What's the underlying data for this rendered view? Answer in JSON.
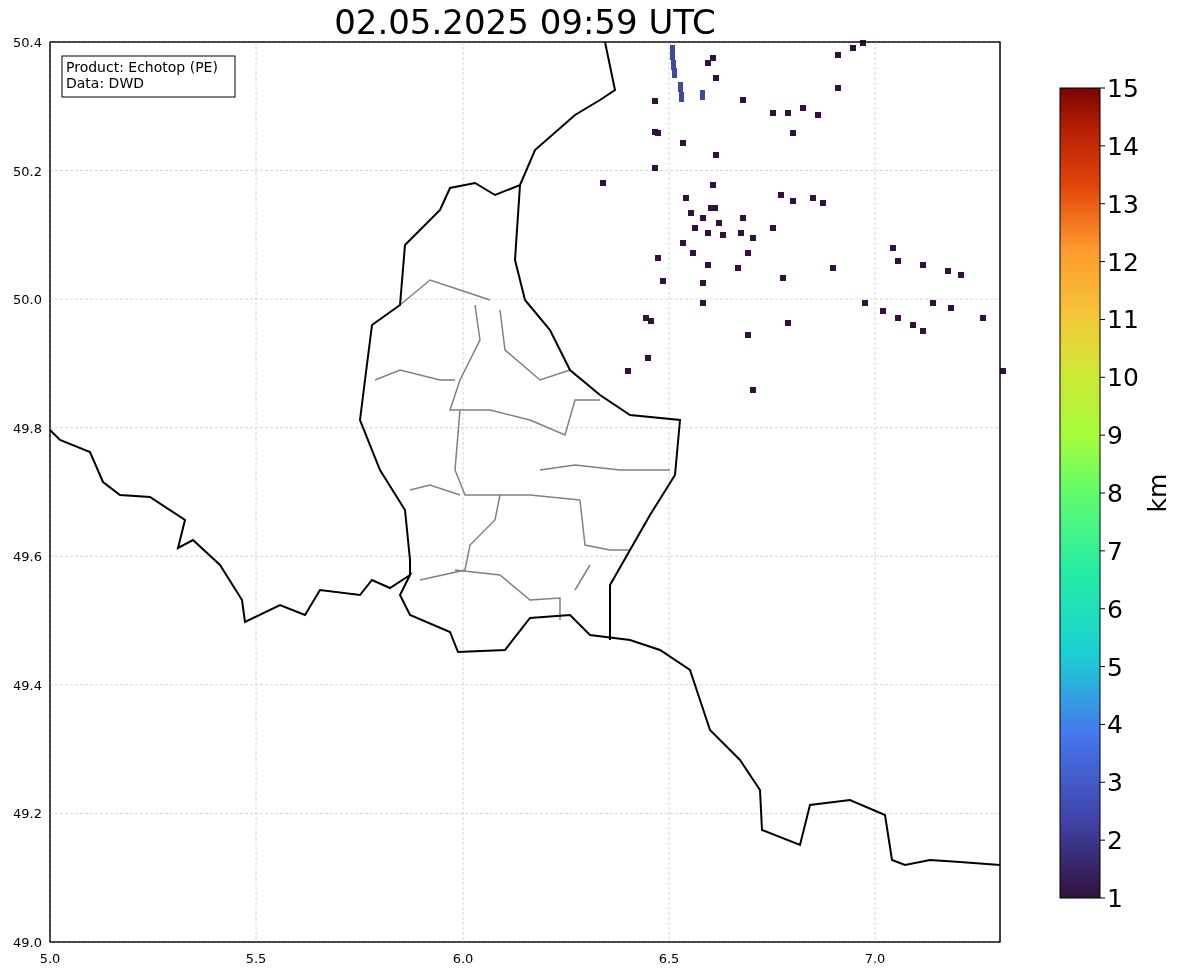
{
  "title": "02.05.2025 09:59 UTC",
  "info_box": [
    "Product: Echotop (PE)",
    "Data: DWD"
  ],
  "map": {
    "x_ticks": [
      "5.0",
      "5.5",
      "6.0",
      "6.5",
      "7.0"
    ],
    "y_ticks": [
      "50.4",
      "50.2",
      "50.0",
      "49.8",
      "49.6",
      "49.4",
      "49.2",
      "49.0"
    ]
  },
  "colorbar": {
    "label": "km",
    "ticks": [
      "15",
      "14",
      "13",
      "12",
      "11",
      "10",
      "9",
      "8",
      "7",
      "6",
      "5",
      "4",
      "3",
      "2",
      "1"
    ]
  }
}
